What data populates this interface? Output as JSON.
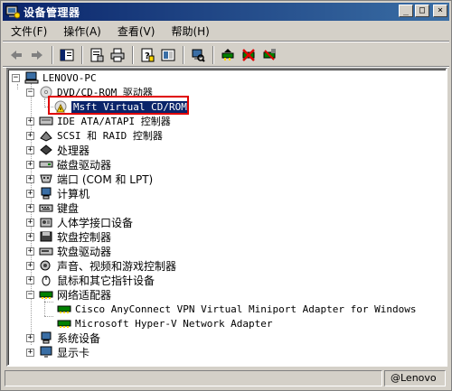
{
  "window": {
    "title": "设备管理器",
    "buttons": {
      "minimize": "_",
      "maximize": "□",
      "close": "×"
    }
  },
  "menu": [
    "文件(F)",
    "操作(A)",
    "查看(V)",
    "帮助(H)"
  ],
  "toolbar": {
    "icons": [
      "back-arrow-icon",
      "forward-arrow-icon",
      "show-hide-tree-icon",
      "properties-icon",
      "print-icon",
      "help-icon",
      "view-icon",
      "scan-hardware-icon",
      "update-driver-icon",
      "disable-device-icon",
      "uninstall-device-icon"
    ]
  },
  "tree": {
    "root": "LENOVO-PC",
    "nodes": [
      {
        "label": "DVD/CD-ROM 驱动器",
        "expanded": true,
        "icon": "dvd-drive-icon"
      },
      {
        "label": "Msft Virtual CD/ROM",
        "child": true,
        "selected": true,
        "icon": "warning-device-icon"
      },
      {
        "label": "IDE ATA/ATAPI 控制器",
        "icon": "ide-controller-icon"
      },
      {
        "label": "SCSI 和 RAID 控制器",
        "icon": "scsi-controller-icon"
      },
      {
        "label": "处理器",
        "icon": "processor-icon"
      },
      {
        "label": "磁盘驱动器",
        "icon": "disk-drive-icon"
      },
      {
        "label": "端口 (COM 和 LPT)",
        "icon": "port-icon"
      },
      {
        "label": "计算机",
        "icon": "computer-icon"
      },
      {
        "label": "键盘",
        "icon": "keyboard-icon"
      },
      {
        "label": "人体学接口设备",
        "icon": "hid-icon"
      },
      {
        "label": "软盘控制器",
        "icon": "floppy-controller-icon"
      },
      {
        "label": "软盘驱动器",
        "icon": "floppy-drive-icon"
      },
      {
        "label": "声音、视频和游戏控制器",
        "icon": "sound-icon"
      },
      {
        "label": "鼠标和其它指针设备",
        "icon": "mouse-icon"
      },
      {
        "label": "网络适配器",
        "expanded": true,
        "icon": "network-adapter-icon"
      },
      {
        "label": "Cisco AnyConnect VPN Virtual Miniport Adapter for Windows",
        "child": true,
        "icon": "network-card-icon"
      },
      {
        "label": "Microsoft Hyper-V Network Adapter",
        "child": true,
        "icon": "network-card-icon"
      },
      {
        "label": "系统设备",
        "icon": "system-device-icon"
      },
      {
        "label": "显示卡",
        "icon": "display-adapter-icon"
      }
    ]
  },
  "status": {
    "watermark": "@Lenovo"
  },
  "colors": {
    "titlebar": "#0a246a",
    "highlight_box": "#e00000",
    "selection": "#0a246a"
  }
}
